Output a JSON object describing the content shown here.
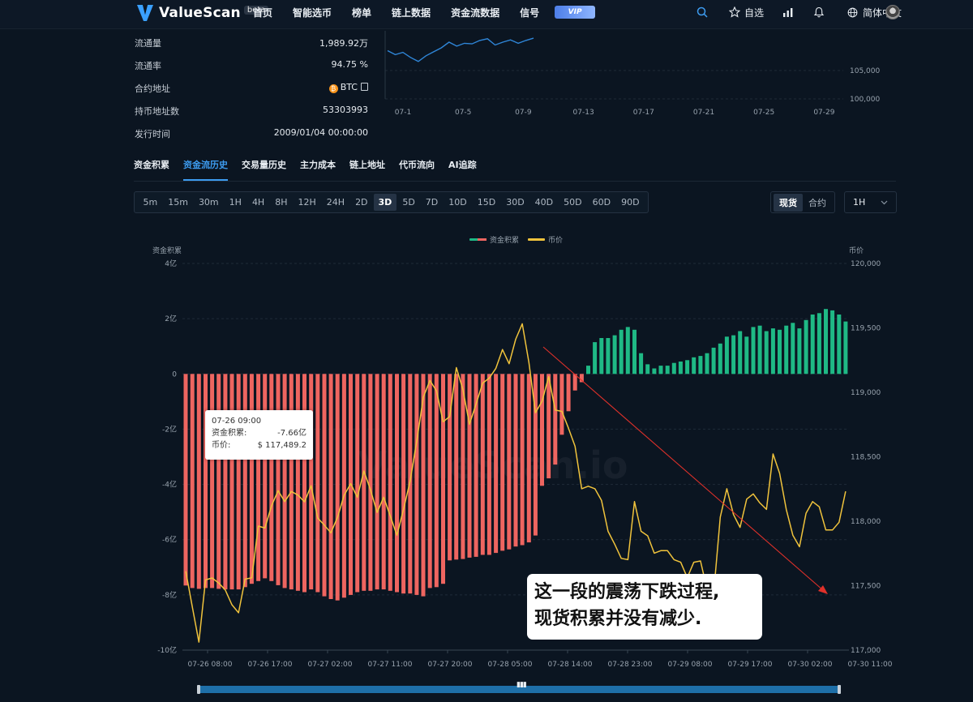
{
  "nav": {
    "brand": "ValueScan",
    "beta": "beta",
    "items": [
      "首页",
      "智能选币",
      "榜单",
      "链上数据",
      "资金流数据",
      "信号"
    ],
    "vip": "VIP",
    "watchlist": "自选",
    "language": "简体中文"
  },
  "info": [
    {
      "label": "流通量",
      "value": "1,989.92万"
    },
    {
      "label": "流通率",
      "value": "94.75 %"
    },
    {
      "label": "合约地址",
      "value": "BTC"
    },
    {
      "label": "持币地址数",
      "value": "53303993"
    },
    {
      "label": "发行时间",
      "value": "2009/01/04 00:00:00"
    }
  ],
  "tabs": [
    "资金积累",
    "资金流历史",
    "交易量历史",
    "主力成本",
    "链上地址",
    "代币流向",
    "AI追踪"
  ],
  "active_tab": 1,
  "intervals": [
    "5m",
    "15m",
    "30m",
    "1H",
    "4H",
    "8H",
    "12H",
    "24H",
    "2D",
    "3D",
    "5D",
    "7D",
    "10D",
    "15D",
    "30D",
    "40D",
    "50D",
    "60D",
    "90D"
  ],
  "active_interval": 9,
  "market": [
    "现货",
    "合约"
  ],
  "active_market": 0,
  "granularity": "1H",
  "colors": {
    "accent": "#3d9cf0",
    "positive": "#1fb985",
    "negative": "#ee6560",
    "price": "#f0c33c",
    "trend": "#e0312a"
  },
  "watermark": "ValueScan.io",
  "tooltip": {
    "time": "07-26 09:00",
    "flow_label": "资金积累:",
    "flow_value": "-7.66亿",
    "price_label": "币价:",
    "price_value": "$ 117,489.2"
  },
  "note": [
    "这一段的震荡下跌过程,",
    "现货积累并没有减少."
  ],
  "chart_data": [
    {
      "type": "line",
      "partial": true,
      "x_ticks": [
        "07-1",
        "07-5",
        "07-9",
        "07-13",
        "07-17",
        "07-21",
        "07-25",
        "07-29"
      ],
      "y_ticks": [
        105000,
        100000
      ],
      "series": [
        {
          "values": [
            108500,
            107800,
            108200,
            107300,
            106600,
            107600,
            108300,
            109000,
            110000,
            109300,
            109800,
            109700,
            110300,
            110600,
            109500,
            110000,
            110400,
            109800,
            110300,
            110700
          ]
        }
      ]
    },
    {
      "type": "bar+line",
      "legend": [
        "资金积累",
        "币价"
      ],
      "left_axis_label": "资金积累",
      "right_axis_label": "币价",
      "left_ticks": [
        "4亿",
        "2亿",
        "0",
        "-2亿",
        "-4亿",
        "-6亿",
        "-8亿",
        "-10亿"
      ],
      "right_ticks": [
        "120,000",
        "119,500",
        "119,000",
        "118,500",
        "118,000",
        "117,500",
        "117,000"
      ],
      "ylim_left": [
        -10,
        4
      ],
      "ylim_right": [
        117000,
        120000
      ],
      "x_ticks": [
        "07-26 08:00",
        "07-26 17:00",
        "07-27 02:00",
        "07-27 11:00",
        "07-27 20:00",
        "07-28 05:00",
        "07-28 14:00",
        "07-28 23:00",
        "07-29 08:00",
        "07-29 17:00",
        "07-30 02:00",
        "07-30 11:00"
      ],
      "flow": [
        -7.66,
        -7.75,
        -7.78,
        -7.75,
        -7.75,
        -7.78,
        -7.8,
        -7.8,
        -7.8,
        -7.72,
        -7.6,
        -7.5,
        -7.4,
        -7.5,
        -7.65,
        -7.75,
        -7.8,
        -7.85,
        -7.9,
        -7.8,
        -7.9,
        -8.05,
        -8.15,
        -8.2,
        -8.1,
        -8.0,
        -7.9,
        -7.85,
        -7.85,
        -7.8,
        -7.8,
        -7.85,
        -7.9,
        -7.95,
        -7.95,
        -8.0,
        -8.05,
        -7.75,
        -7.72,
        -7.6,
        -6.75,
        -6.72,
        -6.7,
        -6.65,
        -6.62,
        -6.55,
        -6.55,
        -6.48,
        -6.4,
        -6.35,
        -6.25,
        -6.2,
        -6.1,
        -5.85,
        -4.05,
        -3.78,
        -3.28,
        -2.2,
        -1.35,
        -0.6,
        -0.3,
        0.3,
        1.15,
        1.3,
        1.3,
        1.4,
        1.6,
        1.7,
        1.6,
        0.75,
        0.35,
        0.2,
        0.3,
        0.3,
        0.4,
        0.45,
        0.5,
        0.6,
        0.65,
        0.75,
        0.95,
        1.1,
        1.35,
        1.4,
        1.55,
        1.35,
        1.7,
        1.75,
        1.55,
        1.65,
        1.6,
        1.75,
        1.85,
        1.65,
        1.95,
        2.15,
        2.2,
        2.35,
        2.3,
        2.15,
        1.9
      ],
      "price": [
        117612,
        117335,
        117062,
        117545,
        117560,
        117520,
        117466,
        117352,
        117290,
        117551,
        117561,
        117962,
        117947,
        118120,
        118237,
        118152,
        118231,
        118203,
        118150,
        118276,
        118025,
        117970,
        117910,
        118031,
        118201,
        118292,
        118186,
        118390,
        118243,
        118068,
        118186,
        118039,
        117891,
        118091,
        118311,
        118619,
        118962,
        119092,
        119012,
        118772,
        118812,
        119192,
        119022,
        118752,
        118911,
        119072,
        119111,
        119187,
        119332,
        119222,
        119412,
        119532,
        119232,
        118842,
        118932,
        119122,
        118862,
        118852,
        118722,
        118582,
        118252,
        118272,
        118252,
        118162,
        117922,
        117822,
        117712,
        117702,
        118152,
        117922,
        117887,
        117752,
        117772,
        117772,
        117702,
        117682,
        117562,
        117682,
        117692,
        117472,
        117442,
        118032,
        118252,
        118052,
        117952,
        118172,
        118212,
        118142,
        118092,
        118522,
        118372,
        118092,
        117892,
        117802,
        118062,
        118152,
        118112,
        117932,
        117932,
        117992,
        118232
      ]
    }
  ]
}
